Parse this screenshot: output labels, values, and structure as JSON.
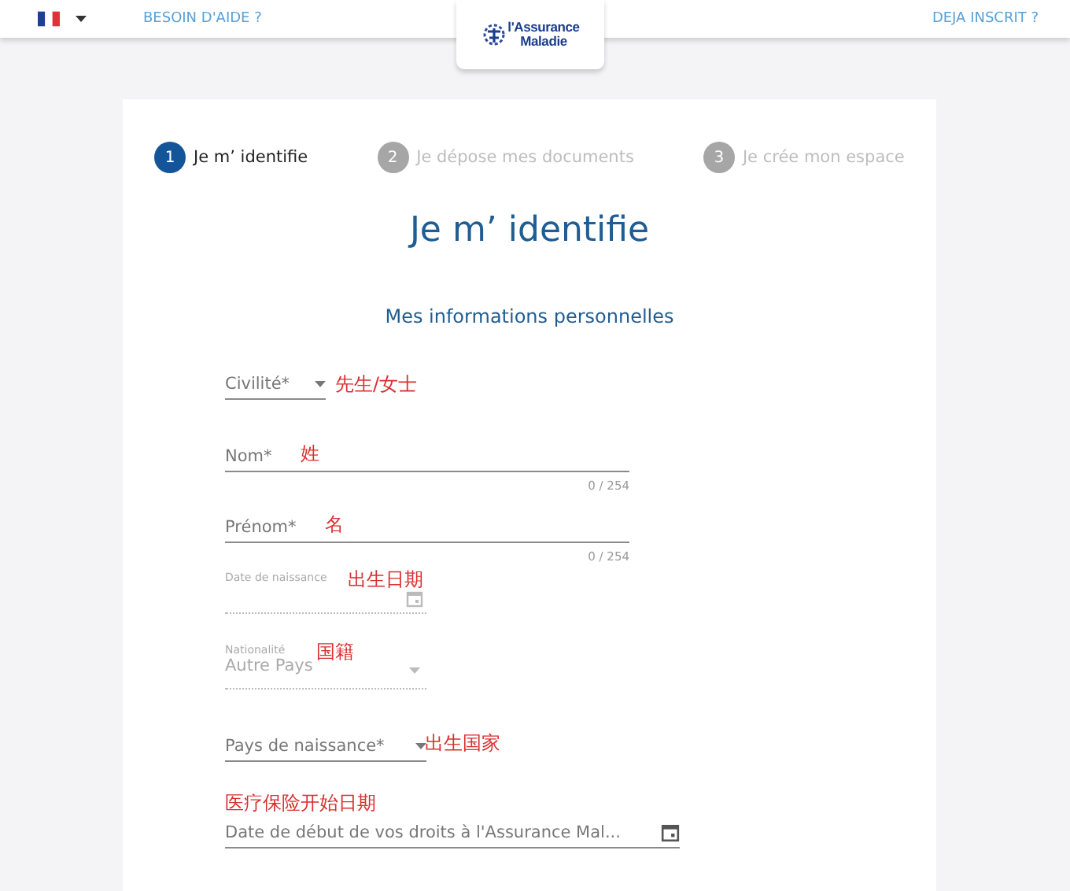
{
  "header": {
    "help_link": "BESOIN D'AIDE ?",
    "logo": [
      "l'Assurance",
      "Maladie"
    ],
    "login_link": "DEJA INSCRIT ?"
  },
  "stepper": [
    {
      "number": "1",
      "label": "Je m’ identifie",
      "selected": true
    },
    {
      "number": "2",
      "label": "Je dépose mes documents",
      "selected": false
    },
    {
      "number": "3",
      "label": "Je crée mon espace",
      "selected": false
    }
  ],
  "title": "Je m’ identifie",
  "section_title": "Mes informations personnelles",
  "fields": [
    {
      "kind": "select",
      "label": "Civilité*",
      "annotation": "先生/女士"
    },
    {
      "kind": "text",
      "label": "Nom*",
      "annotation": "姓",
      "counter": "0 / 254"
    },
    {
      "kind": "text",
      "label": "Prénom*",
      "annotation": "名",
      "counter": "0 / 254"
    },
    {
      "kind": "date",
      "label": "Date de naissance",
      "annotation": "出生日期"
    },
    {
      "kind": "readonly-select",
      "label": "Nationalité",
      "value": "Autre Pays",
      "annotation": "国籍"
    },
    {
      "kind": "select",
      "label": "Pays de naissance*",
      "annotation": "出生国家"
    },
    {
      "kind": "date-long",
      "label": "Date de début de vos droits à l'Assurance Mal...",
      "annotation": "医疗保险开始日期"
    }
  ]
}
